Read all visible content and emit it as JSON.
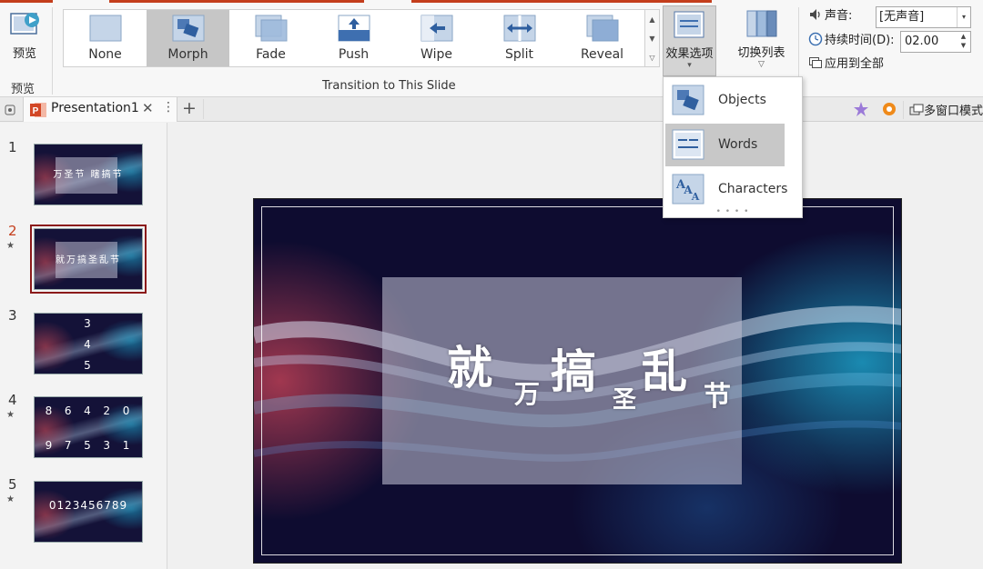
{
  "ribbon": {
    "preview_button": "预览",
    "preview_group": "预览",
    "transition_group": "Transition to This Slide",
    "transitions": [
      {
        "label": "None"
      },
      {
        "label": "Morph",
        "selected": true
      },
      {
        "label": "Fade"
      },
      {
        "label": "Push"
      },
      {
        "label": "Wipe"
      },
      {
        "label": "Split"
      },
      {
        "label": "Reveal"
      }
    ],
    "effect_options": "效果选项",
    "switch_list": "切换列表",
    "sound_label": "声音:",
    "sound_value": "[无声音]",
    "duration_label": "持续时间(D):",
    "duration_value": "02.00",
    "apply_all": "应用到全部"
  },
  "tabs": {
    "document": "Presentation1",
    "multi_window": "多窗口模式"
  },
  "effect_menu": {
    "items": [
      {
        "label": "Objects",
        "icon": "objects-icon"
      },
      {
        "label": "Words",
        "icon": "words-icon",
        "selected": true
      },
      {
        "label": "Characters",
        "icon": "characters-icon"
      }
    ]
  },
  "slides": [
    {
      "number": "1",
      "text": "万圣节 瞎搞节"
    },
    {
      "number": "2",
      "text": "就万搞圣乱节",
      "selected": true
    },
    {
      "number": "3",
      "lines": [
        "3",
        "4",
        "5"
      ]
    },
    {
      "number": "4",
      "lines": [
        "8  6  4  2  0",
        "9  7  5  3  1"
      ]
    },
    {
      "number": "5",
      "lines": [
        "0123456789"
      ]
    }
  ],
  "main_slide": {
    "chars": [
      "就",
      "万",
      "搞",
      "圣",
      "乱",
      "节"
    ]
  },
  "colors": {
    "accent": "#c43e1c",
    "selected_thumb_border": "#8b1a1a",
    "slide_background": "#0e0c30"
  }
}
